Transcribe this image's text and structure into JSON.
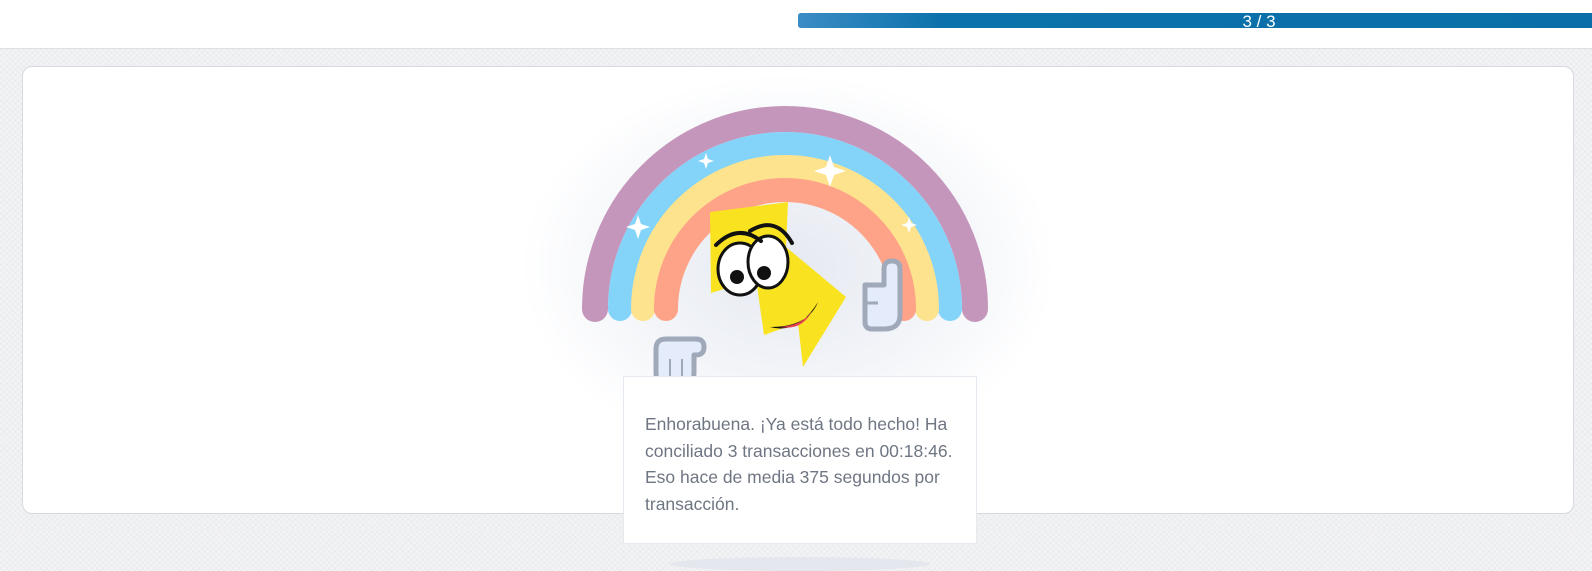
{
  "progress": {
    "label": "3 / 3",
    "current": 3,
    "total": 3,
    "fraction": 1.0,
    "color": "#0a6fa8"
  },
  "message": {
    "text": "Enhorabuena. ¡Ya está todo hecho! Ha conciliado 3 transacciones en 00:18:46. Eso hace de media 375 segundos por transacción."
  },
  "illustration": {
    "name": "rainbow-lightning-mascot",
    "rainbow_colors": [
      "#c596bb",
      "#84d4fa",
      "#fde38d",
      "#fea288"
    ],
    "mascot_color": "#f9e321"
  }
}
